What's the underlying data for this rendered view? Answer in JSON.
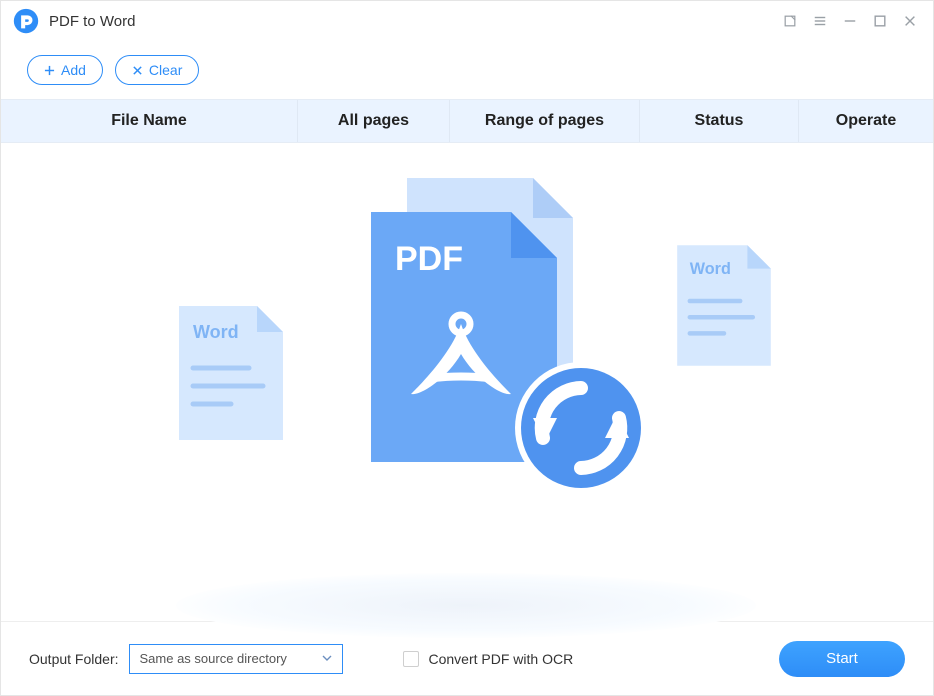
{
  "titlebar": {
    "title": "PDF to Word"
  },
  "toolbar": {
    "add_label": "Add",
    "clear_label": "Clear"
  },
  "table": {
    "headers": {
      "file_name": "File Name",
      "all_pages": "All pages",
      "range_of_pages": "Range of pages",
      "status": "Status",
      "operate": "Operate"
    }
  },
  "empty_state": {
    "pdf_label": "PDF",
    "word_label_left": "Word",
    "word_label_right": "Word"
  },
  "footer": {
    "output_folder_label": "Output Folder:",
    "output_folder_value": "Same as source directory",
    "ocr_label": "Convert PDF with OCR",
    "start_label": "Start"
  },
  "colors": {
    "accent": "#2e8df7",
    "header_bg": "#eaf3ff"
  }
}
